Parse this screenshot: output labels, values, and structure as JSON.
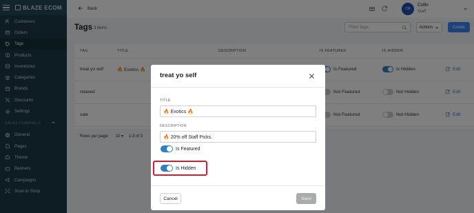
{
  "brand": {
    "name": "BLAZE ECOM"
  },
  "sidebar": {
    "items": [
      {
        "label": "Customers",
        "icon": "users-icon"
      },
      {
        "label": "Orders",
        "icon": "orders-icon"
      },
      {
        "label": "Tags",
        "icon": "tag-icon",
        "active": true
      },
      {
        "label": "Products",
        "icon": "products-icon"
      },
      {
        "label": "Inventories",
        "icon": "inventory-icon"
      },
      {
        "label": "Categories",
        "icon": "categories-icon"
      },
      {
        "label": "Brands",
        "icon": "brands-icon"
      },
      {
        "label": "Discounts",
        "icon": "discount-icon"
      },
      {
        "label": "Settings",
        "icon": "gear-icon"
      }
    ],
    "section_label": "SALES CHANNELS",
    "channel_items": [
      {
        "label": "General",
        "icon": "globe-icon"
      },
      {
        "label": "Pages",
        "icon": "pages-icon"
      },
      {
        "label": "Theme",
        "icon": "theme-icon"
      },
      {
        "label": "Banners",
        "icon": "banner-icon"
      },
      {
        "label": "Campaigns",
        "icon": "campaign-icon"
      },
      {
        "label": "Scan to Shop",
        "icon": "scan-icon"
      }
    ]
  },
  "topbar": {
    "back_label": "Back",
    "user": {
      "initials": "CR",
      "name": "Colin",
      "role": "Staff"
    }
  },
  "page": {
    "title": "Tags",
    "count": "3 items",
    "filter_placeholder": "Filter tags",
    "actions_label": "Actions",
    "create_label": "Create"
  },
  "table": {
    "headers": [
      "TAG",
      "TITLE",
      "DESCRIPTION",
      "IS FEATURED",
      "IS HIDDEN"
    ],
    "rows": [
      {
        "tag": "treat yo self",
        "title": "🔥 Exotics 🔥",
        "featured_label": "Is Featured",
        "featured": true,
        "hidden_label": "Is Hidden",
        "hidden": true
      },
      {
        "tag": "relaxed",
        "title": "",
        "featured_label": "Not Featured",
        "featured": false,
        "hidden_label": "Not Hidden",
        "hidden": false
      },
      {
        "tag": "sale",
        "title": "",
        "featured_label": "Not Featured",
        "featured": false,
        "hidden_label": "Not Hidden",
        "hidden": false
      }
    ],
    "edit_label": "Edit",
    "rows_per_page_label": "Rows per page:",
    "rows_per_page_value": "10",
    "range_label": "1-3 of 3"
  },
  "modal": {
    "title": "treat yo self",
    "title_label": "TITLE",
    "title_value": "🔥 Exotics 🔥",
    "description_label": "DESCRIPTION",
    "description_value": "🔥 20% off Staff Picks.",
    "featured_label": "Is Featured",
    "featured": true,
    "hidden_label": "Is Hidden",
    "hidden": true,
    "cancel_label": "Cancel",
    "save_label": "Save"
  },
  "colors": {
    "accent": "#2f7fc1",
    "highlight": "#d8192f",
    "sidebar": "#1d3a46"
  }
}
